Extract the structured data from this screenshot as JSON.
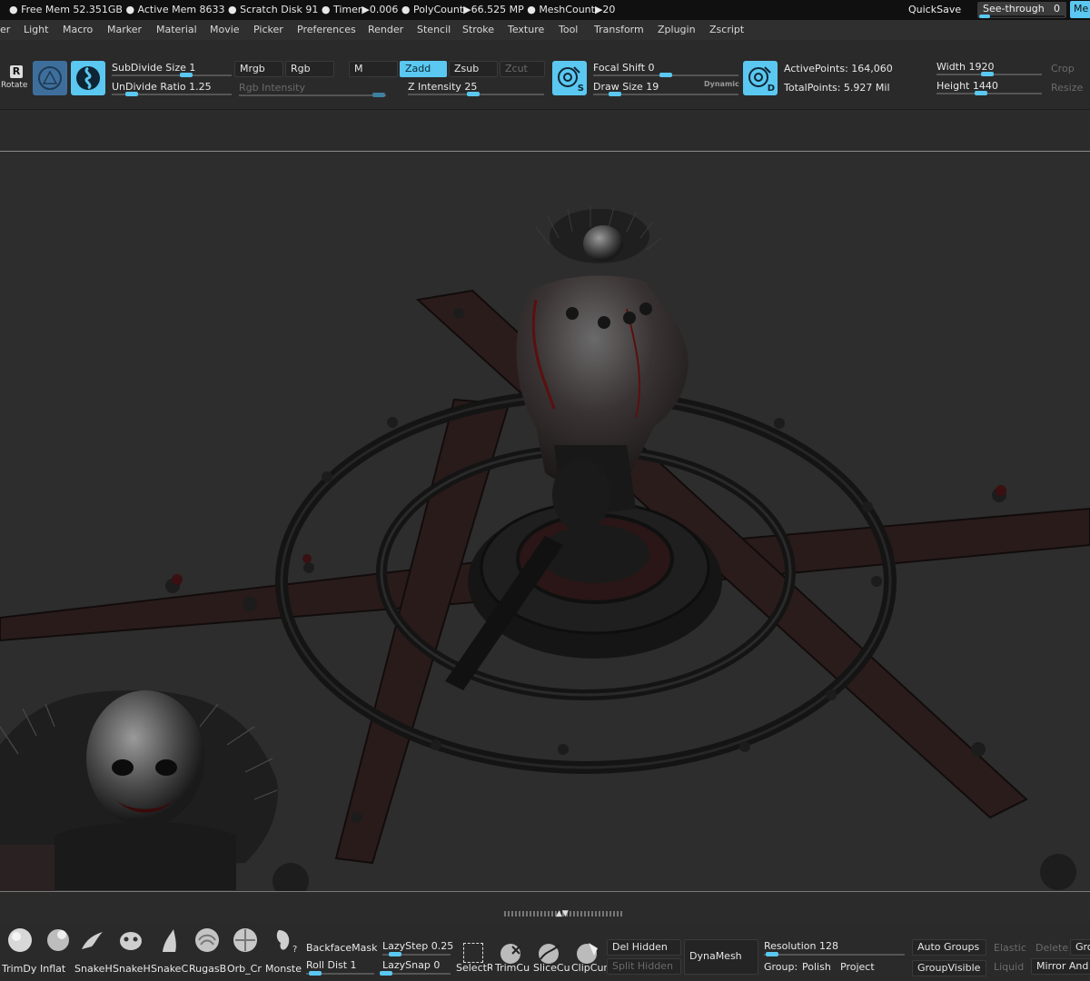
{
  "status": {
    "text": "● Free Mem 52.351GB ● Active Mem 8633 ● Scratch Disk 91 ● Timer▶0.006 ● PolyCount▶66.525 MP ● MeshCount▶20",
    "quicksave": "QuickSave",
    "see_through_label": "See-through",
    "see_through_value": "0",
    "see_through_level": 0,
    "menus_corner": "Me"
  },
  "menubar": {
    "items": [
      "er",
      "Light",
      "Macro",
      "Marker",
      "Material",
      "Movie",
      "Picker",
      "Preferences",
      "Render",
      "Stencil",
      "Stroke",
      "Texture",
      "Tool",
      "Transform",
      "Zplugin",
      "Zscript"
    ]
  },
  "shelf": {
    "rotate_label": "Rotate",
    "rotate_key": "R",
    "subdivide_size": "SubDivide Size 1",
    "undivide_ratio": "UnDivide Ratio 1.25",
    "mrgb": "Mrgb",
    "rgb": "Rgb",
    "m": "M",
    "rgb_intensity": "Rgb Intensity",
    "zadd": "Zadd",
    "zsub": "Zsub",
    "zcut": "Zcut",
    "z_intensity": "Z Intensity 25",
    "focal_shift": "Focal Shift 0",
    "draw_size": "Draw Size 19",
    "dynamic": "Dynamic",
    "active_points": "ActivePoints: 164,060",
    "total_points": "TotalPoints: 5.927 Mil",
    "width": "Width 1920",
    "height": "Height 1440",
    "crop": "Crop",
    "resize": "Resize",
    "icon_s": "S",
    "icon_d": "D"
  },
  "bottom": {
    "brushes": [
      {
        "name": "TrimDy",
        "icon": "trim-dynamic-brush-icon"
      },
      {
        "name": "Inflat",
        "icon": "inflate-brush-icon"
      },
      {
        "name": "SnakeH",
        "icon": "snake-hook-brush-icon"
      },
      {
        "name": "SnakeH",
        "icon": "snake-hook-2-brush-icon"
      },
      {
        "name": "SnakeC",
        "icon": "snake-curve-brush-icon"
      },
      {
        "name": "RugasB",
        "icon": "rugas-brush-icon"
      },
      {
        "name": "Orb_Cr",
        "icon": "orb-cracks-brush-icon"
      },
      {
        "name": "Monste",
        "icon": "monster-brush-icon"
      }
    ],
    "help_mark": "?",
    "backface_mask": "BackfaceMask",
    "roll_dist": "Roll Dist 1",
    "lazy_step": "LazyStep 0.25",
    "lazy_snap": "LazySnap 0",
    "select_rect": "SelectR",
    "trim_curve": "TrimCu",
    "slice_curve": "SliceCu",
    "clip_curve": "ClipCur",
    "del_hidden": "Del Hidden",
    "split_hidden": "Split Hidden",
    "dynamesh": "DynaMesh",
    "resolution": "Resolution 128",
    "group": "Group:",
    "polish": "Polish",
    "project": "Project",
    "auto_groups": "Auto Groups",
    "group_visible": "GroupVisible",
    "elastic": "Elastic",
    "liquid": "Liquid",
    "delete": "Delete",
    "mirror_and": "Mirror And",
    "gro": "Gro"
  },
  "colors": {
    "accent": "#5ac8f0",
    "panel": "#2a2a2a",
    "viewport": "#2d2d2d"
  }
}
